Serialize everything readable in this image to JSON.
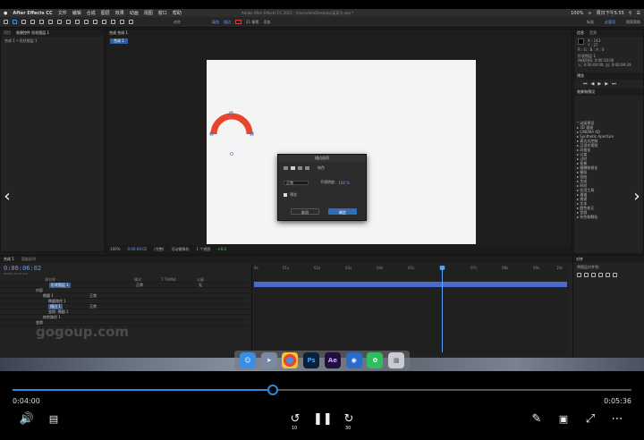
{
  "screen": {
    "menubar": {
      "apple": "",
      "app": "After Effects CC",
      "items": [
        "文件",
        "编辑",
        "合成",
        "图层",
        "效果",
        "动画",
        "视图",
        "窗口",
        "帮助"
      ],
      "window_title": "Adobe After Effects CC 2015 - /Users/ohe/Desktop/某某字.aep *",
      "status": "100%",
      "clock": "周日下午5:55"
    },
    "toolbar": {
      "snap_label": "对齐",
      "fill_label": "填充",
      "stroke_label": "描边",
      "stroke_width": "21 像素",
      "add_label": "添加",
      "workspace_default": "标准",
      "workspace_essential": "必要项",
      "search_placeholder": "搜索帮助"
    },
    "project_panel": {
      "tab_label": "项目",
      "effects_tab": "效果控件 形状图层 1",
      "breadcrumb": "合成 1 • 形状图层 1"
    },
    "comp_panel": {
      "tab_label": "合成 合成 1",
      "subtab": "合成 1",
      "zoom": "100%",
      "timecode": "0:00:06:02",
      "resolution": "(完整)",
      "camera": "活动摄像机",
      "views": "1 个视图",
      "exposure": "+0.0"
    },
    "dialog": {
      "title": "描边选项",
      "mode_label": "正常",
      "opacity_label": "不透明度:",
      "opacity_value": "100 %",
      "stroke_label": "纯色",
      "preview_label": "预览",
      "cancel": "取消",
      "ok": "确定"
    },
    "right_panel": {
      "info_tab": "信息",
      "audio_tab": "音频",
      "x_coord": "X : 143",
      "y_coord": "Y : 27",
      "rgb": "R : G : B : A : 0",
      "layer_name": "形状图层 1",
      "duration": "持续时间: 0:00:10:00",
      "range": "入: 0:00:00:00, 出: 0:00:09:29",
      "preview_tab": "预览",
      "effects_tab": "效果和预设",
      "effects": [
        "* 动画预设",
        "▸ 3D 通道",
        "▸ CINEMA 4D",
        "▸ Synthetic Aperture",
        "▸ 表达式控制",
        "▸ 沉浸式视频",
        "▸ 风格化",
        "▸ 过渡",
        "▸ 过时",
        "▸ 抠像",
        "▸ 模糊和锐化",
        "▸ 模拟",
        "▸ 扭曲",
        "▸ 生成",
        "▸ 时间",
        "▸ 实用工具",
        "▸ 通道",
        "▸ 透视",
        "▸ 文本",
        "▸ 颜色校正",
        "▸ 音频",
        "▸ 杂色和颗粒"
      ],
      "align_tab": "对齐",
      "align_to": "将图层对齐到:"
    },
    "timeline": {
      "tab": "合成 1",
      "render_tab": "渲染队列",
      "timecode": "0:00:06:02",
      "fps": "00182 (30.00 fps)",
      "columns": [
        "源名称",
        "模式",
        "T TrkMat",
        "父级"
      ],
      "rows": [
        {
          "name": "形状图层 1",
          "mode": "正常",
          "parent": "无"
        },
        {
          "name": "内容",
          "mode": "",
          "parent": ""
        },
        {
          "name": "椭圆 1",
          "mode": "正常",
          "parent": ""
        },
        {
          "name": "椭圆路径 1",
          "mode": "",
          "parent": ""
        },
        {
          "name": "描边 1",
          "mode": "正常",
          "parent": ""
        },
        {
          "name": "变换: 椭圆 1",
          "mode": "",
          "parent": ""
        },
        {
          "name": "修剪路径 1",
          "mode": "",
          "parent": ""
        },
        {
          "name": "变换",
          "mode": "",
          "parent": ""
        }
      ],
      "ruler": [
        "0s",
        "01s",
        "02s",
        "03s",
        "04s",
        "05s",
        "06s",
        "07s",
        "08s",
        "09s",
        "10s"
      ]
    },
    "dock_icons": [
      "finder-icon",
      "launchpad-icon",
      "chrome-icon",
      "photoshop-icon",
      "aftereffects-icon",
      "qq-icon",
      "evernote-icon",
      "trash-icon"
    ],
    "ps_label": "Ps",
    "ae_label": "Ae",
    "watermark": "gogoup.com"
  },
  "player": {
    "current_time": "0:04:00",
    "total_time": "0:05:36",
    "progress": 0.42,
    "skip_back": "10",
    "skip_forward": "30",
    "accent": "#2e8ade"
  }
}
